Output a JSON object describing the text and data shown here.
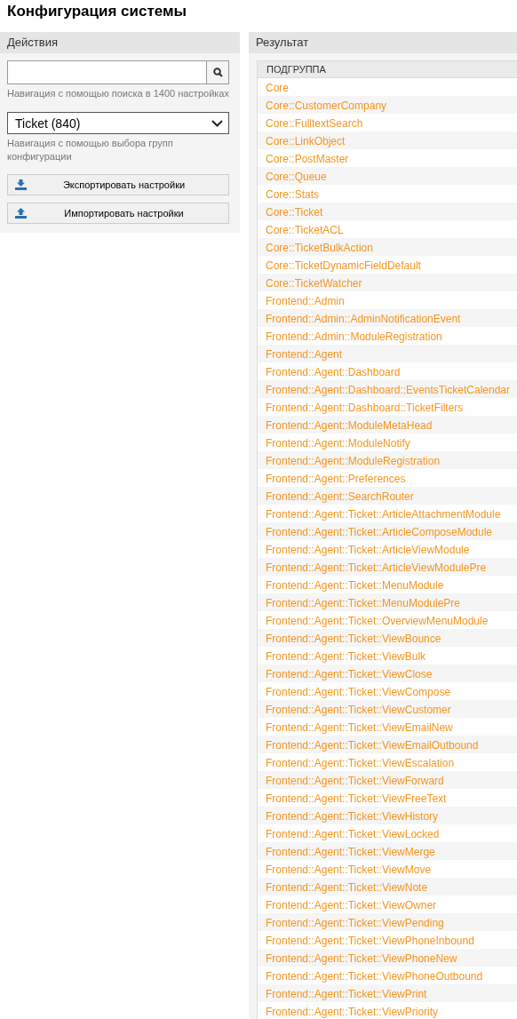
{
  "title": "Конфигурация системы",
  "actions": {
    "header": "Действия",
    "search": {
      "hint": "Навигация с помощью поиска в 1400 настройках"
    },
    "group_select": {
      "value": "Ticket (840)",
      "hint": "Навигация с помощью выбора групп конфигурации"
    },
    "buttons": [
      {
        "label": "Экспортировать настройки",
        "kind": "export"
      },
      {
        "label": "Импортировать настройки",
        "kind": "import"
      }
    ]
  },
  "result": {
    "header": "Результат",
    "column": "ПОДГРУППА",
    "rows": [
      "Core",
      "Core::CustomerCompany",
      "Core::FulltextSearch",
      "Core::LinkObject",
      "Core::PostMaster",
      "Core::Queue",
      "Core::Stats",
      "Core::Ticket",
      "Core::TicketACL",
      "Core::TicketBulkAction",
      "Core::TicketDynamicFieldDefault",
      "Core::TicketWatcher",
      "Frontend::Admin",
      "Frontend::Admin::AdminNotificationEvent",
      "Frontend::Admin::ModuleRegistration",
      "Frontend::Agent",
      "Frontend::Agent::Dashboard",
      "Frontend::Agent::Dashboard::EventsTicketCalendar",
      "Frontend::Agent::Dashboard::TicketFilters",
      "Frontend::Agent::ModuleMetaHead",
      "Frontend::Agent::ModuleNotify",
      "Frontend::Agent::ModuleRegistration",
      "Frontend::Agent::Preferences",
      "Frontend::Agent::SearchRouter",
      "Frontend::Agent::Ticket::ArticleAttachmentModule",
      "Frontend::Agent::Ticket::ArticleComposeModule",
      "Frontend::Agent::Ticket::ArticleViewModule",
      "Frontend::Agent::Ticket::ArticleViewModulePre",
      "Frontend::Agent::Ticket::MenuModule",
      "Frontend::Agent::Ticket::MenuModulePre",
      "Frontend::Agent::Ticket::OverviewMenuModule",
      "Frontend::Agent::Ticket::ViewBounce",
      "Frontend::Agent::Ticket::ViewBulk",
      "Frontend::Agent::Ticket::ViewClose",
      "Frontend::Agent::Ticket::ViewCompose",
      "Frontend::Agent::Ticket::ViewCustomer",
      "Frontend::Agent::Ticket::ViewEmailNew",
      "Frontend::Agent::Ticket::ViewEmailOutbound",
      "Frontend::Agent::Ticket::ViewEscalation",
      "Frontend::Agent::Ticket::ViewForward",
      "Frontend::Agent::Ticket::ViewFreeText",
      "Frontend::Agent::Ticket::ViewHistory",
      "Frontend::Agent::Ticket::ViewLocked",
      "Frontend::Agent::Ticket::ViewMerge",
      "Frontend::Agent::Ticket::ViewMove",
      "Frontend::Agent::Ticket::ViewNote",
      "Frontend::Agent::Ticket::ViewOwner",
      "Frontend::Agent::Ticket::ViewPending",
      "Frontend::Agent::Ticket::ViewPhoneInbound",
      "Frontend::Agent::Ticket::ViewPhoneNew",
      "Frontend::Agent::Ticket::ViewPhoneOutbound",
      "Frontend::Agent::Ticket::ViewPrint",
      "Frontend::Agent::Ticket::ViewPriority"
    ]
  }
}
